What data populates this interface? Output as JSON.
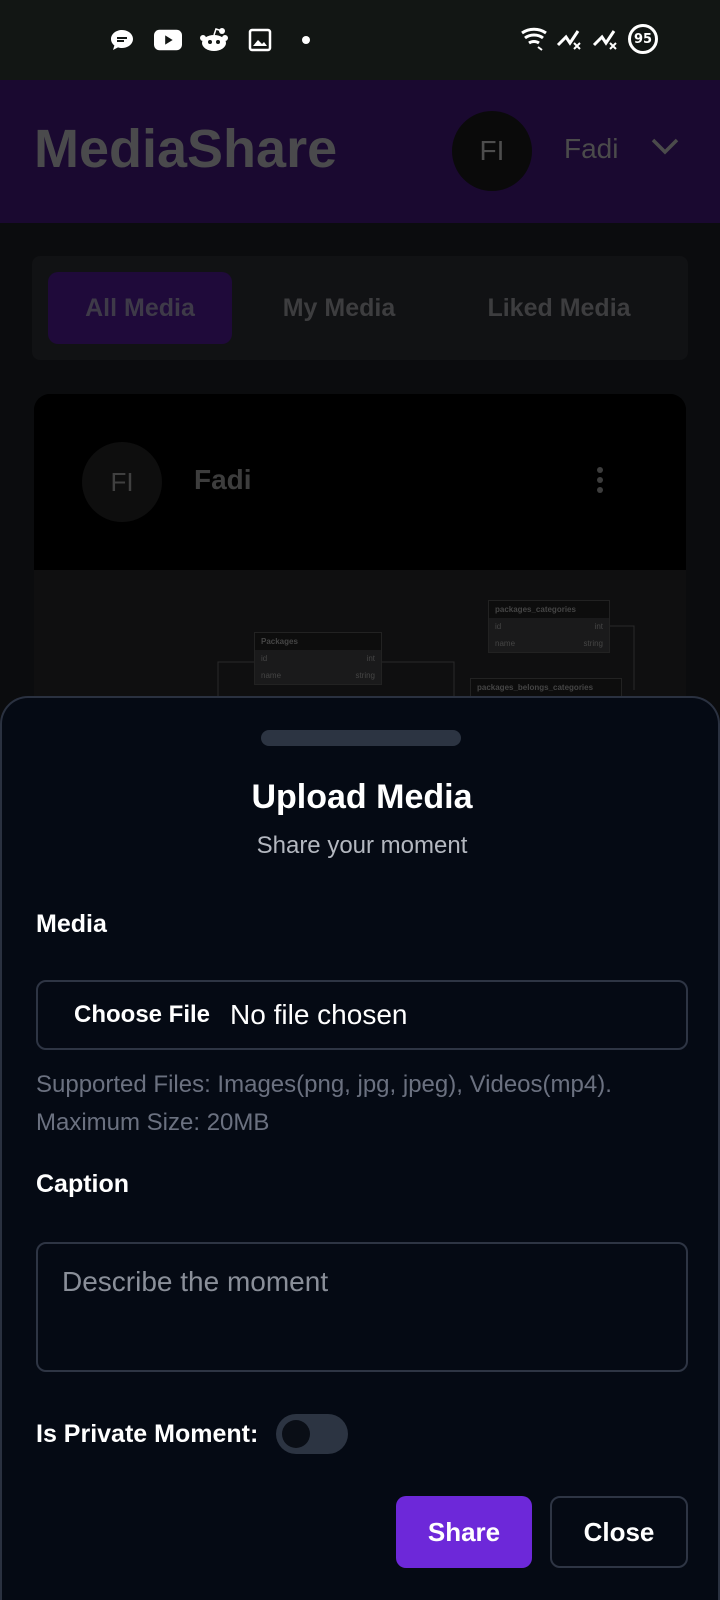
{
  "status_bar": {
    "left_icons": [
      "chat-bubble-icon",
      "youtube-icon",
      "reddit-icon",
      "image-icon",
      "dot-icon"
    ],
    "right_icons": [
      "wifi-icon",
      "signal-x-icon",
      "signal-x-icon"
    ],
    "battery": "95"
  },
  "header": {
    "app_title": "MediaShare",
    "avatar_initials": "FI",
    "user_name": "Fadi"
  },
  "tabs": [
    {
      "label": "All Media",
      "active": true
    },
    {
      "label": "My Media",
      "active": false
    },
    {
      "label": "Liked Media",
      "active": false
    }
  ],
  "media_card": {
    "avatar_initials": "FI",
    "user_name": "Fadi",
    "diagram_tables": [
      {
        "name": "Packages",
        "rows": [
          [
            "id",
            "int"
          ],
          [
            "name",
            "string"
          ]
        ]
      },
      {
        "name": "packages_categories",
        "rows": [
          [
            "id",
            "int"
          ],
          [
            "name",
            "string"
          ]
        ]
      },
      {
        "name": "packages_belongs_categories",
        "rows": []
      }
    ]
  },
  "upload_sheet": {
    "title": "Upload Media",
    "subtitle": "Share your moment",
    "media_label": "Media",
    "choose_file_label": "Choose File",
    "file_status": "No file chosen",
    "hint": "Supported Files: Images(png, jpg, jpeg), Videos(mp4). Maximum Size: 20MB",
    "caption_label": "Caption",
    "caption_placeholder": "Describe the moment",
    "caption_value": "",
    "private_label": "Is Private Moment:",
    "private_on": false,
    "share_label": "Share",
    "close_label": "Close"
  },
  "colors": {
    "accent": "#6d28d9",
    "sheet_bg": "#050a14",
    "border": "#2e3544",
    "header_bg": "#1a0930"
  }
}
